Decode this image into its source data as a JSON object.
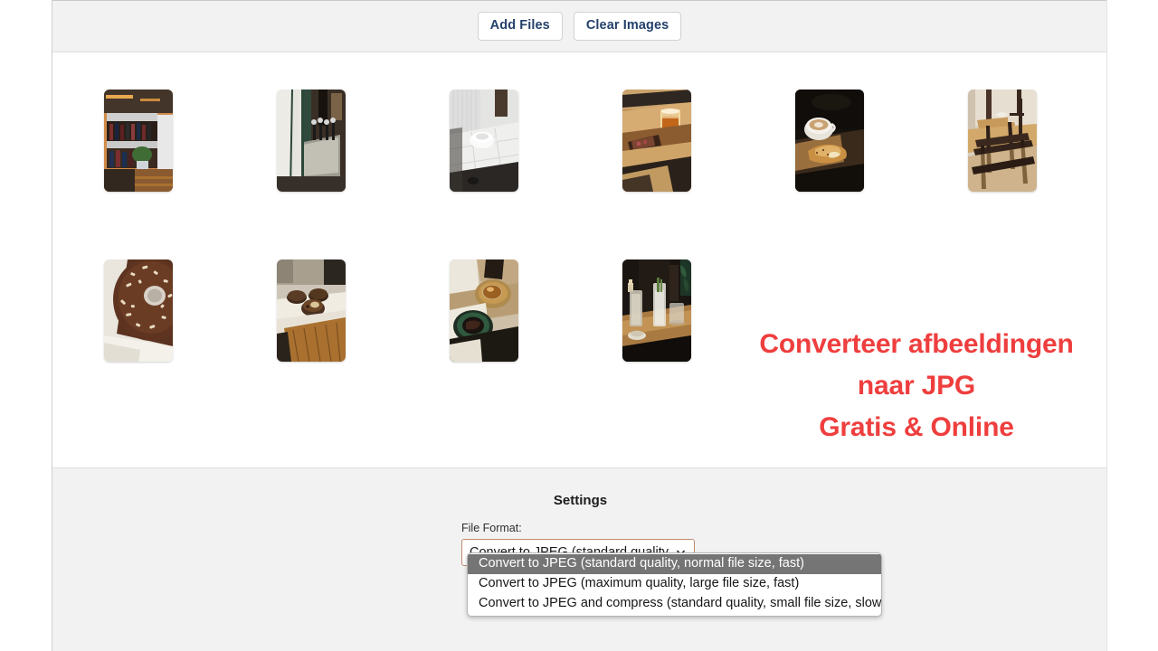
{
  "toolbar": {
    "add_files_label": "Add Files",
    "clear_images_label": "Clear Images"
  },
  "thumbnails": {
    "row1": [
      {
        "alt": "bar-shelves-with-bottles"
      },
      {
        "alt": "beer-taps-on-green-bar"
      },
      {
        "alt": "coffee-cup-on-white-tiled-table"
      },
      {
        "alt": "beer-glass-and-food-on-wooden-board"
      },
      {
        "alt": "latte-and-croissant-dark-table"
      },
      {
        "alt": "cafe-table-and-wooden-chairs"
      }
    ],
    "row2": [
      {
        "alt": "chocolate-donut-with-nuts"
      },
      {
        "alt": "pastries-on-counter"
      },
      {
        "alt": "iced-coffee-and-cake-overhead"
      },
      {
        "alt": "drinks-on-bar-table-dark"
      }
    ]
  },
  "headline": {
    "line1": "Converteer afbeeldingen",
    "line2": "naar JPG",
    "line3": "Gratis & Online",
    "color": "#ef3e3e"
  },
  "settings": {
    "title": "Settings",
    "file_format_label": "File Format:",
    "selected_value": "Convert to JPEG (standard quality,",
    "dropdown_open": true,
    "options": [
      {
        "label": "Convert to JPEG (standard quality, normal file size, fast)",
        "selected": true
      },
      {
        "label": "Convert to JPEG (maximum quality, large file size, fast)",
        "selected": false
      },
      {
        "label": "Convert to JPEG and compress (standard quality, small file size, slow)",
        "selected": false
      }
    ],
    "highlight_color": "#757575",
    "select_border_color": "#c08a6e"
  }
}
